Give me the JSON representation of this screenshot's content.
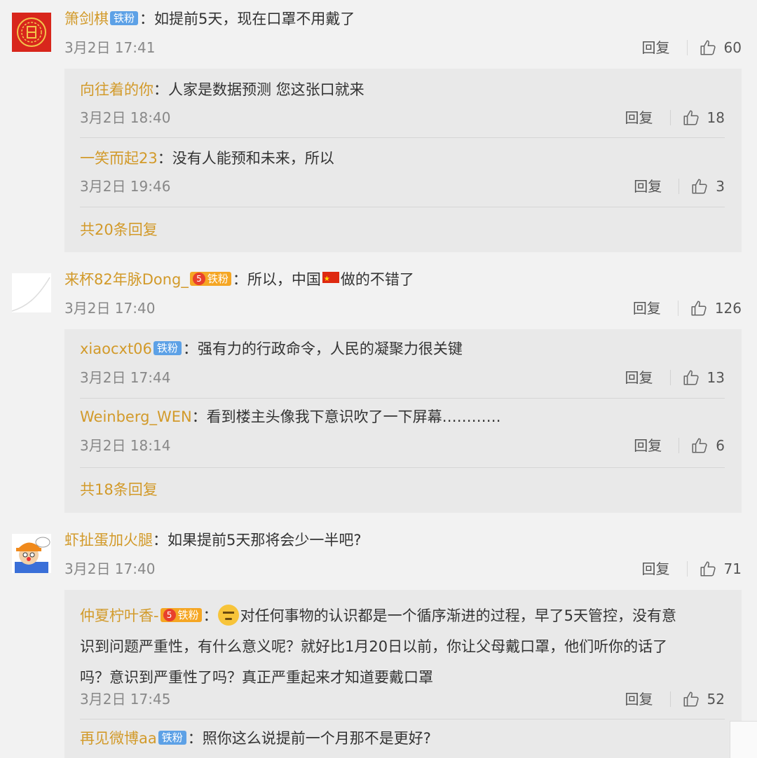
{
  "comments": [
    {
      "user": "箫剑棋",
      "badge": "铁粉",
      "text": "：如提前5天，现在口罩不用戴了",
      "date": "3月2日 17:41",
      "reply_label": "回复",
      "likes": "60",
      "replies": [
        {
          "user": "向往着的你",
          "text": "：人家是数据预测 您这张口就来",
          "date": "3月2日 18:40",
          "reply_label": "回复",
          "likes": "18"
        },
        {
          "user": "一笑而起23",
          "text": "：没有人能预和未来，所以",
          "date": "3月2日 19:46",
          "reply_label": "回复",
          "likes": "3"
        }
      ],
      "more": "共20条回复"
    },
    {
      "user": "来杯82年脉Dong_",
      "badge": "铁粉",
      "badge_level": "5",
      "text_before": "：所以，中国",
      "text_after": "做的不错了",
      "date": "3月2日 17:40",
      "reply_label": "回复",
      "likes": "126",
      "replies": [
        {
          "user": "xiaocxt06",
          "badge": "铁粉",
          "text": "：强有力的行政命令，人民的凝聚力很关键",
          "date": "3月2日 17:44",
          "reply_label": "回复",
          "likes": "13"
        },
        {
          "user": "Weinberg_WEN",
          "text": "：看到楼主头像我下意识吹了一下屏幕…………",
          "date": "3月2日 18:14",
          "reply_label": "回复",
          "likes": "6"
        }
      ],
      "more": "共18条回复"
    },
    {
      "user": "虾扯蛋加火腿",
      "text": "：如果提前5天那将会少一半吧?",
      "date": "3月2日 17:40",
      "reply_label": "回复",
      "likes": "71",
      "replies": [
        {
          "user": "仲夏柠叶香-",
          "badge": "铁粉",
          "badge_level": "5",
          "text_line1": "对任何事物的认识都是一个循序渐进的过程，早了5天管控，没有意",
          "text_line2": "识到问题严重性，有什么意义呢？就好比1月20日以前，你让父母戴口罩，他们听你的话了",
          "text_line3": "吗？意识到严重性了吗？真正严重起来才知道要戴口罩",
          "date": "3月2日 17:45",
          "reply_label": "回复",
          "likes": "52"
        },
        {
          "user": "再见微博aa",
          "badge": "铁粉",
          "text": "：照你这么说提前一个月那不是更好?"
        }
      ]
    }
  ],
  "colors": {
    "username": "#d29a2a",
    "badge_blue": "#5da1e6",
    "badge_gold": "#f5a623"
  }
}
